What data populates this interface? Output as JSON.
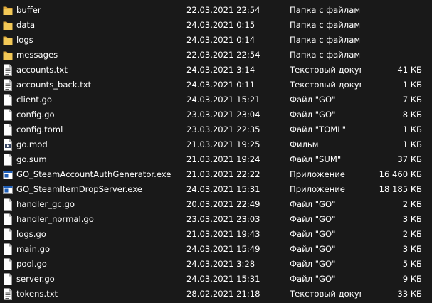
{
  "files": [
    {
      "name": "buffer",
      "date": "22.03.2021 22:54",
      "type": "Папка с файлами",
      "size": "",
      "icon": "folder-icon"
    },
    {
      "name": "data",
      "date": "24.03.2021 0:15",
      "type": "Папка с файлами",
      "size": "",
      "icon": "folder-icon"
    },
    {
      "name": "logs",
      "date": "24.03.2021 0:14",
      "type": "Папка с файлами",
      "size": "",
      "icon": "folder-icon"
    },
    {
      "name": "messages",
      "date": "22.03.2021 22:54",
      "type": "Папка с файлами",
      "size": "",
      "icon": "folder-icon"
    },
    {
      "name": "accounts.txt",
      "date": "24.03.2021 3:14",
      "type": "Текстовый докум...",
      "size": "41 КБ",
      "icon": "text-file-icon"
    },
    {
      "name": "accounts_back.txt",
      "date": "24.03.2021 0:11",
      "type": "Текстовый докум...",
      "size": "1 КБ",
      "icon": "text-file-icon"
    },
    {
      "name": "client.go",
      "date": "24.03.2021 15:21",
      "type": "Файл \"GO\"",
      "size": "7 КБ",
      "icon": "file-icon"
    },
    {
      "name": "config.go",
      "date": "23.03.2021 23:04",
      "type": "Файл \"GO\"",
      "size": "8 КБ",
      "icon": "file-icon"
    },
    {
      "name": "config.toml",
      "date": "23.03.2021 22:35",
      "type": "Файл \"TOML\"",
      "size": "1 КБ",
      "icon": "file-icon"
    },
    {
      "name": "go.mod",
      "date": "21.03.2021 19:25",
      "type": "Фильм",
      "size": "1 КБ",
      "icon": "movie-file-icon"
    },
    {
      "name": "go.sum",
      "date": "21.03.2021 19:24",
      "type": "Файл \"SUM\"",
      "size": "37 КБ",
      "icon": "file-icon"
    },
    {
      "name": "GO_SteamAccountAuthGenerator.exe",
      "date": "21.03.2021 22:22",
      "type": "Приложение",
      "size": "16 460 КБ",
      "icon": "application-icon"
    },
    {
      "name": "GO_SteamItemDropServer.exe",
      "date": "24.03.2021 15:31",
      "type": "Приложение",
      "size": "18 185 КБ",
      "icon": "application-icon"
    },
    {
      "name": "handler_gc.go",
      "date": "20.03.2021 22:49",
      "type": "Файл \"GO\"",
      "size": "2 КБ",
      "icon": "file-icon"
    },
    {
      "name": "handler_normal.go",
      "date": "23.03.2021 23:03",
      "type": "Файл \"GO\"",
      "size": "3 КБ",
      "icon": "file-icon"
    },
    {
      "name": "logs.go",
      "date": "21.03.2021 19:43",
      "type": "Файл \"GO\"",
      "size": "2 КБ",
      "icon": "file-icon"
    },
    {
      "name": "main.go",
      "date": "24.03.2021 15:49",
      "type": "Файл \"GO\"",
      "size": "3 КБ",
      "icon": "file-icon"
    },
    {
      "name": "pool.go",
      "date": "24.03.2021 3:28",
      "type": "Файл \"GO\"",
      "size": "5 КБ",
      "icon": "file-icon"
    },
    {
      "name": "server.go",
      "date": "24.03.2021 15:31",
      "type": "Файл \"GO\"",
      "size": "9 КБ",
      "icon": "file-icon"
    },
    {
      "name": "tokens.txt",
      "date": "28.02.2021 21:18",
      "type": "Текстовый докум...",
      "size": "33 КБ",
      "icon": "text-file-icon"
    }
  ],
  "colors": {
    "background": "#191919",
    "text": "#ffffff",
    "folder": "#f2c857",
    "folder_tab": "#e0a93a",
    "file_page": "#ffffff",
    "file_fold": "#c8c8c8",
    "app_accent": "#1f5fb8"
  }
}
